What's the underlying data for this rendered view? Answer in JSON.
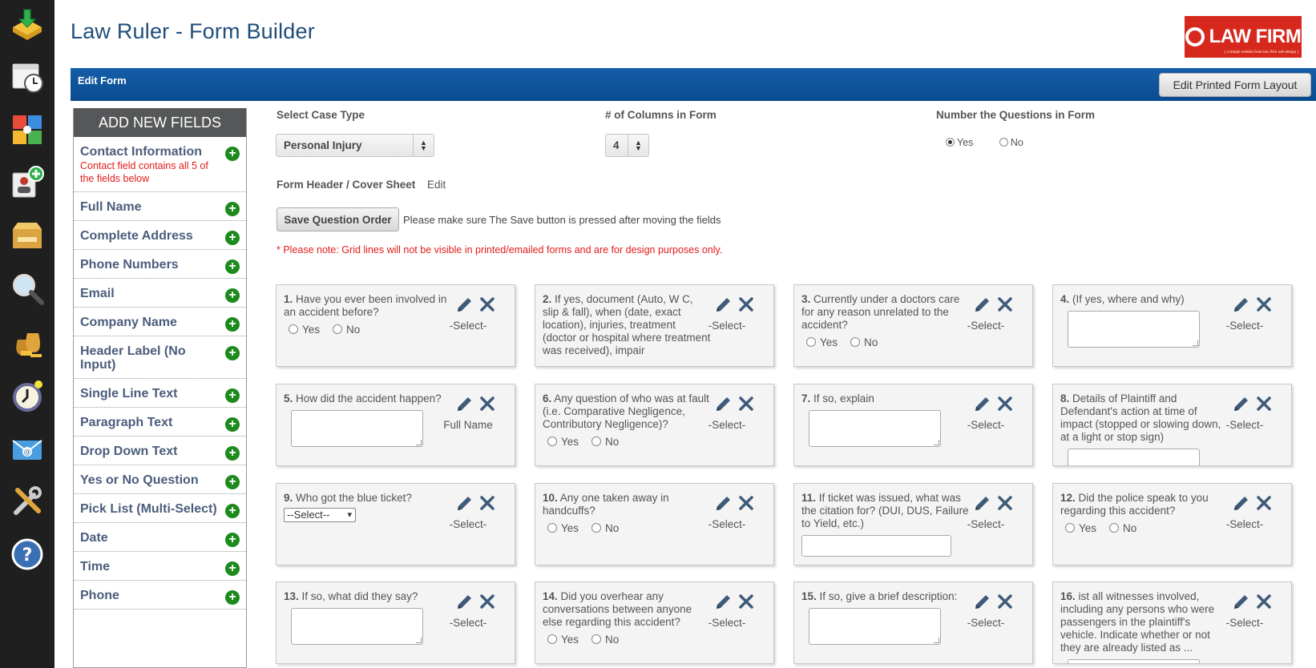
{
  "app": {
    "title": "Law Ruler - Form Builder"
  },
  "logo": {
    "text": "LAW FIRM",
    "tagline": "( a simple website from law firm web design )"
  },
  "colors": {
    "accent": "#0a4b8f",
    "plus": "#1c8a1c",
    "note": "#e31b1b",
    "title": "#1f4e79"
  },
  "rail": {
    "icons": [
      "download-tray-icon",
      "calendar-clock-icon",
      "calendar-grid-icon",
      "add-contact-icon",
      "reports-box-icon",
      "magnifier-icon",
      "money-bags-icon",
      "stopwatch-icon",
      "email-icon",
      "tools-icon",
      "help-icon"
    ]
  },
  "toolbar": {
    "title": "Edit Form",
    "edit_layout_label": "Edit Printed Form Layout"
  },
  "panel": {
    "heading": "ADD NEW FIELDS",
    "fields": [
      {
        "label": "Contact Information",
        "note": "Contact field contains all 5 of the fields below"
      },
      {
        "label": "Full Name"
      },
      {
        "label": "Complete Address"
      },
      {
        "label": "Phone Numbers"
      },
      {
        "label": "Email"
      },
      {
        "label": "Company Name"
      },
      {
        "label": "Header Label (No Input)"
      },
      {
        "label": "Single Line Text"
      },
      {
        "label": "Paragraph Text"
      },
      {
        "label": "Drop Down Text"
      },
      {
        "label": "Yes or No Question"
      },
      {
        "label": "Pick List (Multi-Select)"
      },
      {
        "label": "Date"
      },
      {
        "label": "Time"
      },
      {
        "label": "Phone"
      }
    ]
  },
  "settings": {
    "case_type_label": "Select Case Type",
    "case_type_value": "Personal Injury",
    "columns_label": "# of Columns in Form",
    "columns_value": "4",
    "number_label": "Number the Questions in Form",
    "number_yes": "Yes",
    "number_no": "No",
    "number_selected": "Yes",
    "header_label": "Form Header / Cover Sheet",
    "header_edit": "Edit",
    "save_label": "Save Question Order",
    "save_hint": "Please make sure The Save button is pressed after moving the fields",
    "grid_note": "* Please note: Grid lines will not be visible in printed/emailed forms and are for design purposes only."
  },
  "questions": [
    {
      "num": "1.",
      "text": "Have you ever been involved in an accident before?",
      "input": "yesno",
      "assign": "-Select-"
    },
    {
      "num": "2.",
      "text": "If yes, document (Auto, W C, slip & fall), when (date, exact location), injuries, treatment (doctor or hospital where treatment was received), impair",
      "input": "none",
      "assign": "-Select-"
    },
    {
      "num": "3.",
      "text": "Currently under a doctors care for any reason unrelated to the accident?",
      "input": "yesno",
      "assign": "-Select-"
    },
    {
      "num": "4.",
      "text": "(If yes, where and why)",
      "input": "textarea",
      "assign": "-Select-"
    },
    {
      "num": "5.",
      "text": "How did the accident happen?",
      "input": "textarea",
      "assign": "Full Name"
    },
    {
      "num": "6.",
      "text": "Any question of who was at fault (i.e. Comparative Negligence, Contributory Negligence)?",
      "input": "yesno",
      "assign": "-Select-"
    },
    {
      "num": "7.",
      "text": "If so, explain",
      "input": "textarea",
      "assign": "-Select-"
    },
    {
      "num": "8.",
      "text": "Details of Plaintiff and Defendant's action at time of impact (stopped or slowing down, at a light or stop sign)",
      "input": "textarea",
      "assign": "-Select-"
    },
    {
      "num": "9.",
      "text": "Who got the blue ticket?",
      "input": "dropdown",
      "dropdown_value": "--Select--",
      "assign": "-Select-"
    },
    {
      "num": "10.",
      "text": "Any one taken away in handcuffs?",
      "input": "yesno",
      "assign": "-Select-"
    },
    {
      "num": "11.",
      "text": "If ticket was issued, what was the citation for? (DUI, DUS, Failure to Yield, etc.)",
      "input": "text",
      "assign": "-Select-"
    },
    {
      "num": "12.",
      "text": "Did the police speak to you regarding this accident?",
      "input": "yesno",
      "assign": "-Select-"
    },
    {
      "num": "13.",
      "text": "If so, what did they say?",
      "input": "textarea",
      "assign": "-Select-"
    },
    {
      "num": "14.",
      "text": "Did you overhear any conversations between anyone else regarding this accident?",
      "input": "yesno",
      "assign": "-Select-"
    },
    {
      "num": "15.",
      "text": "If so, give a brief description:",
      "input": "textarea",
      "assign": "-Select-"
    },
    {
      "num": "16.",
      "text": "ist all witnesses involved, including any persons who were passengers in the plaintiff's vehicle. Indicate whether or not they are already listed as ...",
      "input": "textarea",
      "assign": "-Select-"
    }
  ],
  "yes_label": "Yes",
  "no_label": "No"
}
